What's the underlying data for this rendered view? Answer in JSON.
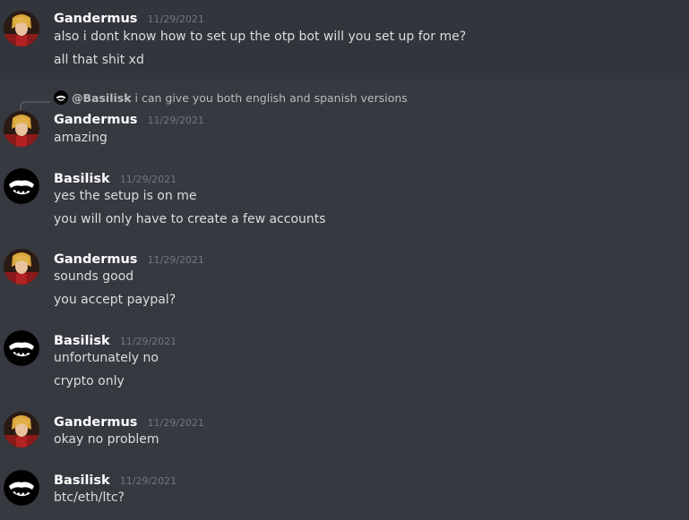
{
  "messages": [
    {
      "author": "Gandermus",
      "timestamp": "11/29/2021",
      "avatar": "gandermus-avatar",
      "lines": [
        "also i dont know how to set up the otp bot will you set up for me?",
        "all that shit xd"
      ]
    },
    {
      "reply": {
        "author": "@Basilisk",
        "text": "i can give you both english and spanish versions"
      },
      "author": "Gandermus",
      "timestamp": "11/29/2021",
      "avatar": "gandermus-avatar",
      "lines": [
        "amazing"
      ]
    },
    {
      "author": "Basilisk",
      "timestamp": "11/29/2021",
      "avatar": "basilisk-avatar",
      "lines": [
        "yes the setup is on me",
        "you will only have to create a few accounts"
      ]
    },
    {
      "author": "Gandermus",
      "timestamp": "11/29/2021",
      "avatar": "gandermus-avatar",
      "lines": [
        "sounds good",
        "you accept paypal?"
      ]
    },
    {
      "author": "Basilisk",
      "timestamp": "11/29/2021",
      "avatar": "basilisk-avatar",
      "lines": [
        "unfortunately no",
        "crypto only"
      ]
    },
    {
      "author": "Gandermus",
      "timestamp": "11/29/2021",
      "avatar": "gandermus-avatar",
      "lines": [
        "okay no problem"
      ]
    },
    {
      "author": "Basilisk",
      "timestamp": "11/29/2021",
      "avatar": "basilisk-avatar",
      "lines": [
        "btc/eth/ltc?"
      ]
    }
  ],
  "colors": {
    "background": "#36393f",
    "username": "#ffffff",
    "timestamp": "#72767d",
    "message_text": "#dcddde"
  }
}
